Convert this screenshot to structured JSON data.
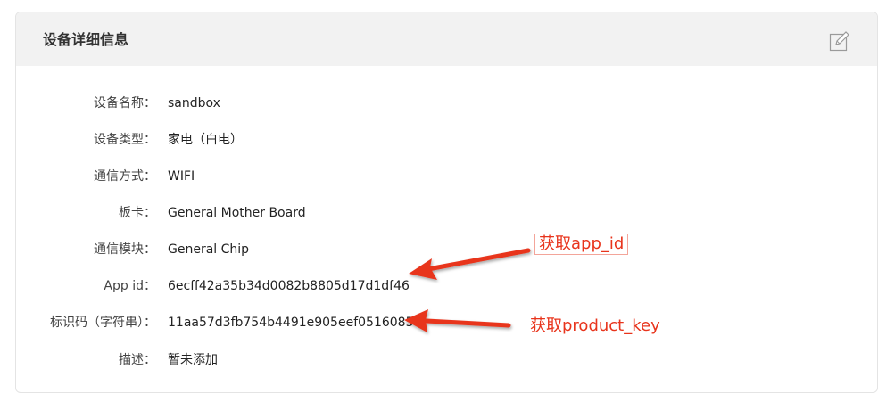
{
  "panel": {
    "title": "设备详细信息",
    "edit_icon": "edit-icon"
  },
  "details": [
    {
      "label": "设备名称：",
      "value": "sandbox"
    },
    {
      "label": "设备类型：",
      "value": "家电（白电）"
    },
    {
      "label": "通信方式：",
      "value": "WIFI"
    },
    {
      "label": "板卡：",
      "value": "General Mother Board"
    },
    {
      "label": "通信模块：",
      "value": "General Chip"
    },
    {
      "label": "App id：",
      "value": "6ecff42a35b34d0082b8805d17d1df46"
    },
    {
      "label": "标识码（字符串）：",
      "value": "11aa57d3fb754b4491e905eef0516085"
    },
    {
      "label": "描述：",
      "value": "暂未添加"
    }
  ],
  "annotations": {
    "app_id": "获取app_id",
    "product_key": "获取product_key",
    "color": "#e8341c"
  }
}
